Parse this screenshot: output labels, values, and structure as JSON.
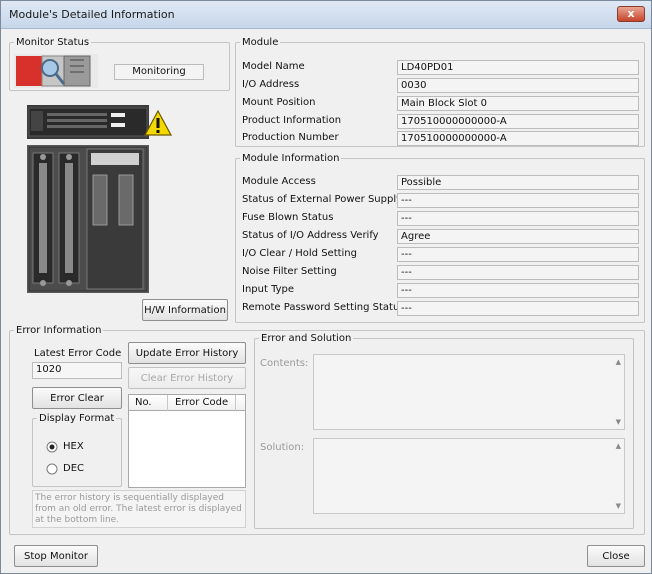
{
  "window": {
    "title": "Module's Detailed Information",
    "close_glyph": "x"
  },
  "monitor_status": {
    "legend": "Monitor Status",
    "status_value": "Monitoring"
  },
  "module": {
    "legend": "Module",
    "rows": [
      {
        "label": "Model Name",
        "value": "LD40PD01"
      },
      {
        "label": "I/O Address",
        "value": "0030"
      },
      {
        "label": "Mount Position",
        "value": "Main Block Slot 0"
      },
      {
        "label": "Product Information",
        "value": "170510000000000-A"
      },
      {
        "label": "Production Number",
        "value": "170510000000000-A"
      }
    ]
  },
  "module_information": {
    "legend": "Module Information",
    "rows": [
      {
        "label": "Module Access",
        "value": "Possible"
      },
      {
        "label": "Status of External Power Supply",
        "value": "---"
      },
      {
        "label": "Fuse Blown Status",
        "value": "---"
      },
      {
        "label": "Status of I/O Address Verify",
        "value": "Agree"
      },
      {
        "label": "I/O Clear / Hold Setting",
        "value": "---"
      },
      {
        "label": "Noise Filter Setting",
        "value": "---"
      },
      {
        "label": "Input Type",
        "value": "---"
      },
      {
        "label": "Remote Password Setting Status",
        "value": "---"
      }
    ]
  },
  "hw_info_button": "H/W Information",
  "warning_icon": "warning-triangle-icon",
  "error_information": {
    "legend": "Error Information",
    "latest_error_label": "Latest Error Code",
    "latest_error_value": "1020",
    "update_history_button": "Update Error History",
    "clear_history_button": "Clear Error History",
    "error_clear_button": "Error Clear",
    "history_table": {
      "col_no": "No.",
      "col_code": "Error Code"
    },
    "display_format": {
      "legend": "Display Format",
      "options": [
        {
          "label": "HEX",
          "selected": true
        },
        {
          "label": "DEC",
          "selected": false
        }
      ]
    },
    "note": "The error history is sequentially displayed from an old error. The latest error is displayed at the bottom line."
  },
  "error_solution": {
    "legend": "Error and Solution",
    "contents_label": "Contents:",
    "solution_label": "Solution:"
  },
  "footer": {
    "stop_monitor": "Stop Monitor",
    "close": "Close"
  },
  "colors": {
    "title_bar": "#c6d6ea",
    "close_button": "#c7442a",
    "warning": "#f5d800"
  }
}
